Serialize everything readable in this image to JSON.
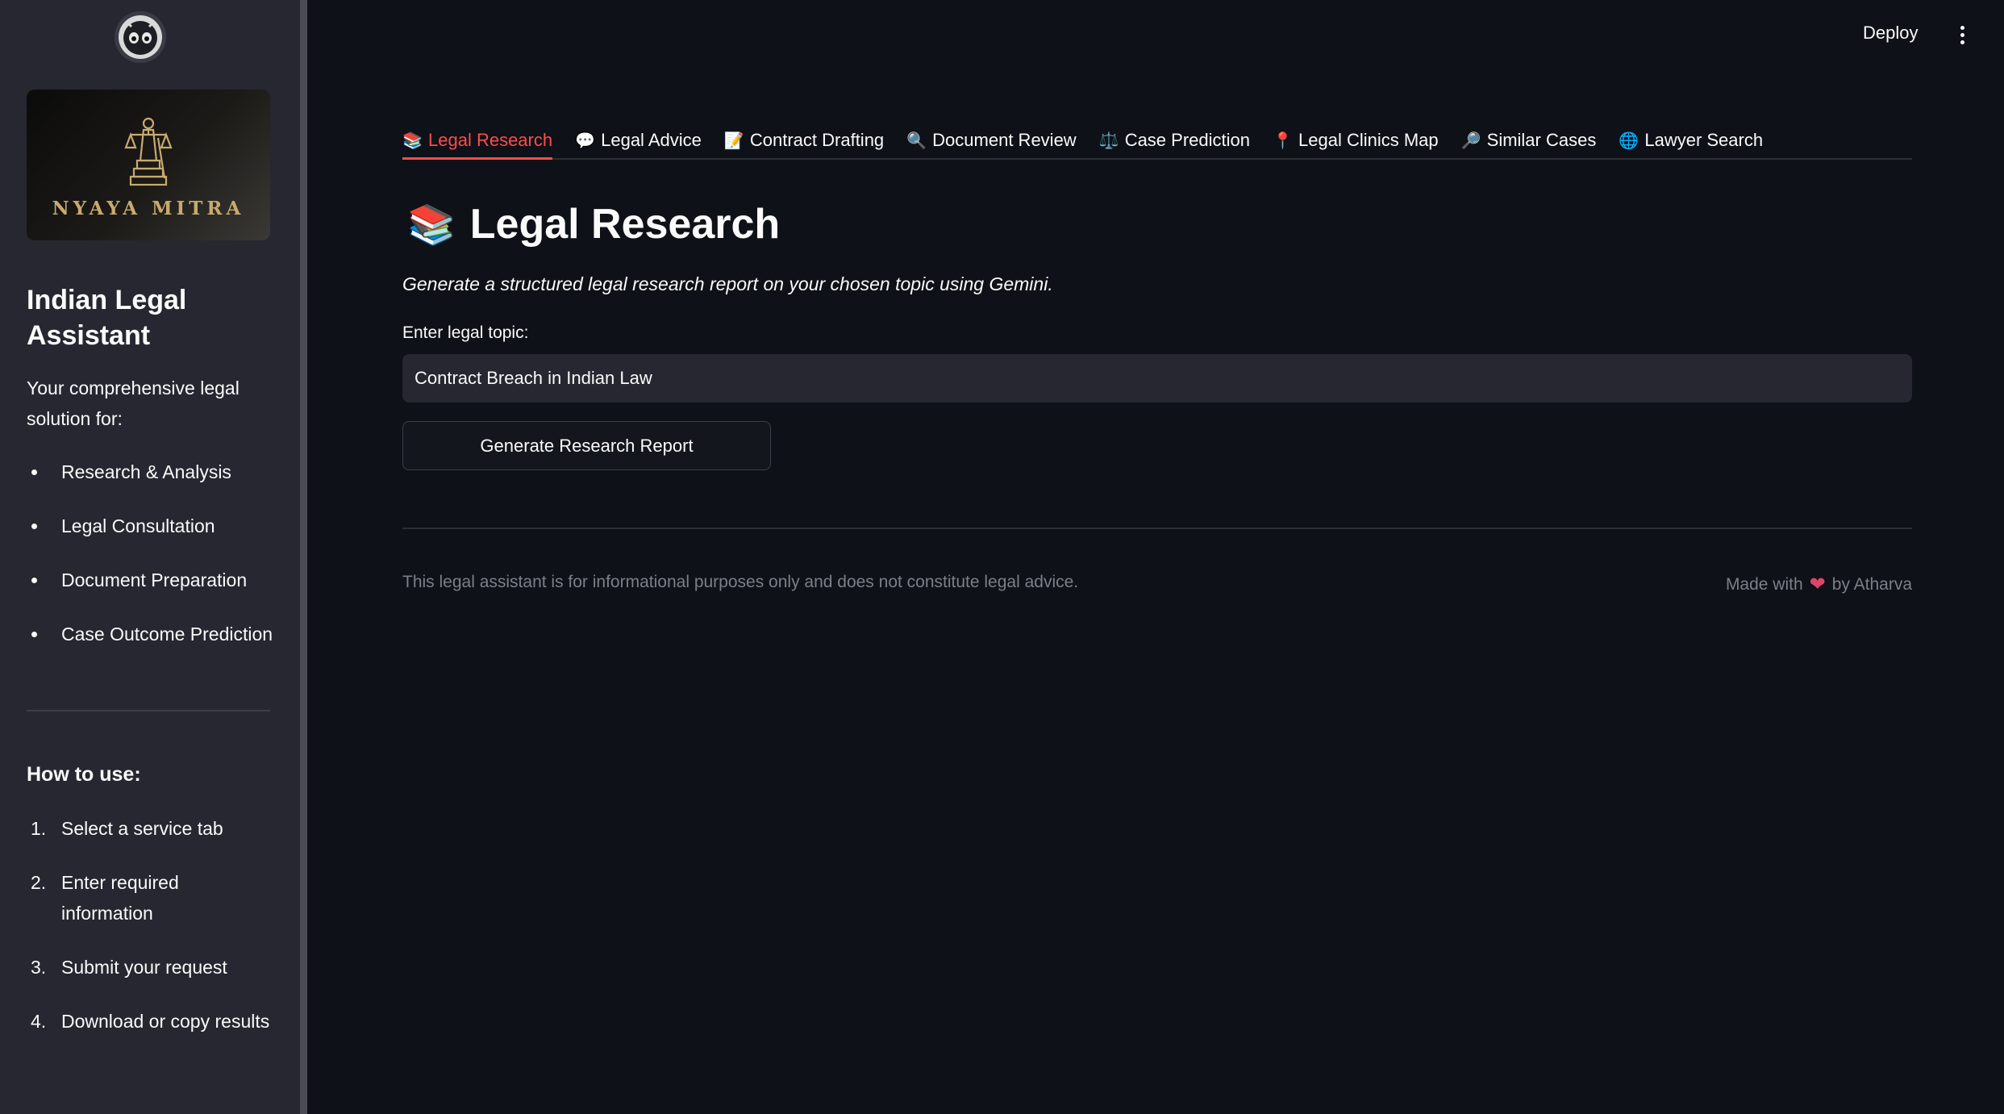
{
  "sidebar": {
    "logo_text": "NYAYA MITRA",
    "app_title": "Indian Legal Assistant",
    "description": "Your comprehensive legal solution for:",
    "features": [
      "Research & Analysis",
      "Legal Consultation",
      "Document Preparation",
      "Case Outcome Prediction"
    ],
    "howto_title": "How to use:",
    "steps": [
      {
        "num": "1.",
        "text": "Select a service tab"
      },
      {
        "num": "2.",
        "text": "Enter required information"
      },
      {
        "num": "3.",
        "text": "Submit your request"
      },
      {
        "num": "4.",
        "text": "Download or copy results"
      }
    ]
  },
  "header": {
    "deploy_label": "Deploy"
  },
  "tabs": [
    {
      "icon": "📚",
      "label": "Legal Research",
      "active": true
    },
    {
      "icon": "💬",
      "label": "Legal Advice"
    },
    {
      "icon": "📝",
      "label": "Contract Drafting"
    },
    {
      "icon": "🔍",
      "label": "Document Review"
    },
    {
      "icon": "⚖️",
      "label": "Case Prediction"
    },
    {
      "icon": "📍",
      "label": "Legal Clinics Map"
    },
    {
      "icon": "🔎",
      "label": "Similar Cases"
    },
    {
      "icon": "🌐",
      "label": "Lawyer Search"
    }
  ],
  "main": {
    "title_icon": "📚",
    "title": "Legal Research",
    "subtitle": "Generate a structured legal research report on your chosen topic using Gemini.",
    "input_label": "Enter legal topic:",
    "input_value": "Contract Breach in Indian Law",
    "button_label": "Generate Research Report"
  },
  "footer": {
    "disclaimer": "This legal assistant is for informational purposes only and does not constitute legal advice.",
    "made_with": "Made with",
    "heart": "❤",
    "by": "by Atharva"
  },
  "colors": {
    "accent": "#ff4b4b",
    "background": "#0e1117",
    "sidebar": "#262730"
  }
}
